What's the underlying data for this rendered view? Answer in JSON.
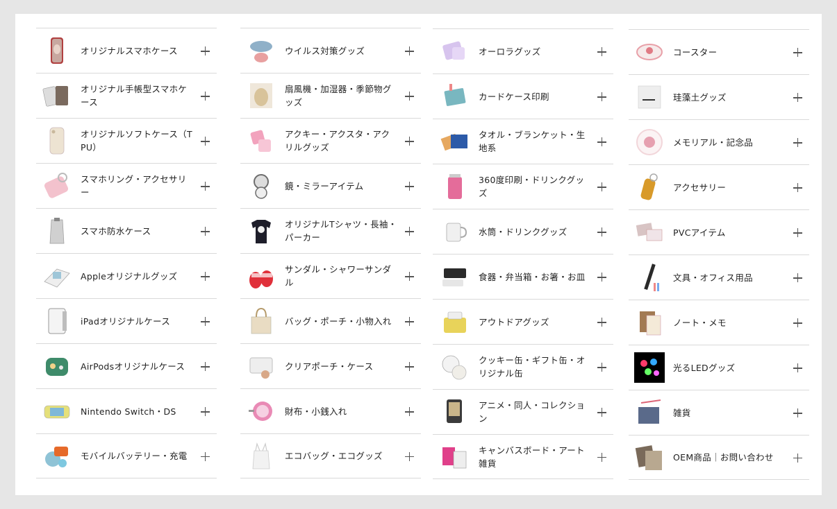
{
  "columns": [
    {
      "items": [
        {
          "label": "オリジナルスマホケース",
          "icon": "phone-case-icon",
          "color": "#c8a8a0"
        },
        {
          "label": "オリジナル手帳型スマホケース",
          "icon": "notebook-case-icon",
          "color": "#7a6a5e"
        },
        {
          "label": "オリジナルソフトケース（TPU）",
          "icon": "soft-case-icon",
          "color": "#ede3d2"
        },
        {
          "label": "スマホリング・アクセサリー",
          "icon": "phone-ring-icon",
          "color": "#f3c2cd"
        },
        {
          "label": "スマホ防水ケース",
          "icon": "waterproof-case-icon",
          "color": "#d0d0d0"
        },
        {
          "label": "Appleオリジナルグッズ",
          "icon": "apple-goods-icon",
          "color": "#9fc6d8"
        },
        {
          "label": "iPadオリジナルケース",
          "icon": "ipad-case-icon",
          "color": "#bdbdbd"
        },
        {
          "label": "AirPodsオリジナルケース",
          "icon": "airpods-case-icon",
          "color": "#3e8b6a"
        },
        {
          "label": "Nintendo Switch・DS",
          "icon": "game-console-icon",
          "color": "#e5e07a"
        },
        {
          "label": "モバイルバッテリー・充電",
          "icon": "battery-icon",
          "color": "#8fc3d6"
        }
      ]
    },
    {
      "items": [
        {
          "label": "ウイルス対策グッズ",
          "icon": "mask-icon",
          "color": "#8fb0c8"
        },
        {
          "label": "扇風機・加湿器・季節物グッズ",
          "icon": "humidifier-icon",
          "color": "#d8c39a"
        },
        {
          "label": "アクキー・アクスタ・アクリルグッズ",
          "icon": "acrylic-goods-icon",
          "color": "#f2a3bd"
        },
        {
          "label": "鏡・ミラーアイテム",
          "icon": "mirror-icon",
          "color": "#6d6d6d"
        },
        {
          "label": "オリジナルTシャツ・長袖・パーカー",
          "icon": "tshirt-icon",
          "color": "#1e1e2a"
        },
        {
          "label": "サンダル・シャワーサンダル",
          "icon": "sandal-icon",
          "color": "#e0303a"
        },
        {
          "label": "バッグ・ポーチ・小物入れ",
          "icon": "tote-bag-icon",
          "color": "#e9dcc3"
        },
        {
          "label": "クリアポーチ・ケース",
          "icon": "clear-pouch-icon",
          "color": "#c9c9c9"
        },
        {
          "label": "財布・小銭入れ",
          "icon": "coin-purse-icon",
          "color": "#e98ab5"
        },
        {
          "label": "エコバッグ・エコグッズ",
          "icon": "eco-bag-icon",
          "color": "#f2f2f2"
        }
      ]
    },
    {
      "items": [
        {
          "label": "オーロラグッズ",
          "icon": "aurora-goods-icon",
          "color": "#d7c4ee"
        },
        {
          "label": "カードケース印刷",
          "icon": "card-case-icon",
          "color": "#79b7c0"
        },
        {
          "label": "タオル・ブランケット・生地系",
          "icon": "towel-icon",
          "color": "#2c5aa8"
        },
        {
          "label": "360度印刷・ドリンクグッズ",
          "icon": "tumbler-icon",
          "color": "#e46c9a"
        },
        {
          "label": "水筒・ドリンクグッズ",
          "icon": "mug-icon",
          "color": "#f0f0f0"
        },
        {
          "label": "食器・弁当箱・お箸・お皿",
          "icon": "lunch-box-icon",
          "color": "#2a2a2a"
        },
        {
          "label": "アウトドアグッズ",
          "icon": "outdoor-goods-icon",
          "color": "#e8d35a"
        },
        {
          "label": "クッキー缶・ギフト缶・オリジナル缶",
          "icon": "gift-can-icon",
          "color": "#f3f3f3"
        },
        {
          "label": "アニメ・同人・コレクション",
          "icon": "collection-icon",
          "color": "#3b3b3b"
        },
        {
          "label": "キャンバスボード・アート雑貨",
          "icon": "canvas-board-icon",
          "color": "#e0408a"
        }
      ]
    },
    {
      "items": [
        {
          "label": "コースター",
          "icon": "coaster-icon",
          "color": "#e8a0a8"
        },
        {
          "label": "珪藻土グッズ",
          "icon": "diatomite-icon",
          "color": "#eeeeee"
        },
        {
          "label": "メモリアル・記念品",
          "icon": "memorial-plate-icon",
          "color": "#f2d6da"
        },
        {
          "label": "アクセサリー",
          "icon": "keychain-icon",
          "color": "#d89a2a"
        },
        {
          "label": "PVCアイテム",
          "icon": "pvc-item-icon",
          "color": "#d8c4c4"
        },
        {
          "label": "文具・オフィス用品",
          "icon": "pen-icon",
          "color": "#2a2a2a"
        },
        {
          "label": "ノート・メモ",
          "icon": "notebook-icon",
          "color": "#a27a52"
        },
        {
          "label": "光るLEDグッズ",
          "icon": "led-goods-icon",
          "color": "#000000"
        },
        {
          "label": "雑貨",
          "icon": "misc-goods-icon",
          "color": "#5a6a8a"
        },
        {
          "label": "OEM商品｜お問い合わせ",
          "icon": "oem-product-icon",
          "color": "#7a6a5a"
        }
      ]
    }
  ]
}
